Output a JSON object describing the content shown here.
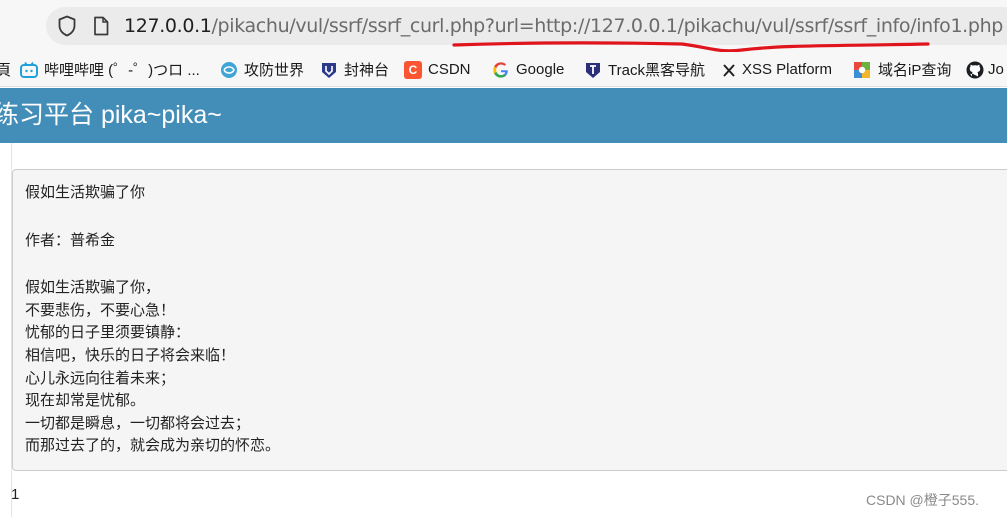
{
  "browser": {
    "url_host": "127.0.0.1",
    "url_path": "/pikachu/vul/ssrf/ssrf_curl.php?url=http://127.0.0.1/pikachu/vul/ssrf/ssrf_info/info1.php",
    "underline_color": "#e0141c"
  },
  "bookmarks": [
    {
      "label": "頁",
      "icon": "partial"
    },
    {
      "label": "哔哩哔哩 (゜-゜)つロ ...",
      "icon": "bilibili-icon"
    },
    {
      "label": "攻防世界",
      "icon": "adworld-icon"
    },
    {
      "label": "封神台",
      "icon": "fengshentai-icon"
    },
    {
      "label": "CSDN",
      "icon": "csdn-icon"
    },
    {
      "label": "Google",
      "icon": "google-icon"
    },
    {
      "label": "Track黑客导航",
      "icon": "track-icon"
    },
    {
      "label": "XSS Platform",
      "icon": "xss-icon"
    },
    {
      "label": "域名iP查询",
      "icon": "domain-icon"
    },
    {
      "label": "Jo",
      "icon": "github-icon"
    }
  ],
  "header": {
    "title": "练习平台 pika~pika~",
    "background": "#438eb9"
  },
  "poem": {
    "title": "假如生活欺骗了你",
    "author": "作者：普希金",
    "lines": [
      "假如生活欺骗了你，",
      "不要悲伤，不要心急！",
      "忧郁的日子里须要镇静：",
      "相信吧，快乐的日子将会来临！",
      "心儿永远向往着未来；",
      "现在却常是忧郁。",
      "一切都是瞬息，一切都将会过去；",
      "而那过去了的，就会成为亲切的怀恋。"
    ]
  },
  "footer": {
    "page_number": "1",
    "watermark": "CSDN @橙子555."
  }
}
